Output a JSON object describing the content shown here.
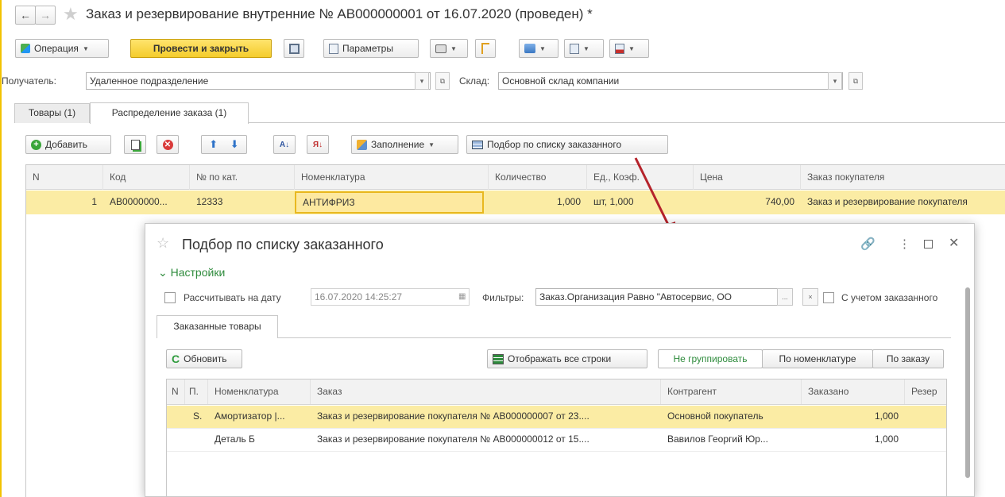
{
  "window": {
    "title": "Заказ и резервирование внутренние № АВ000000001 от 16.07.2020 (проведен) *"
  },
  "toolbar": {
    "operation_label": "Операция",
    "post_close_label": "Провести и закрыть",
    "params_label": "Параметры"
  },
  "header_fields": {
    "recipient_label": "Получатель:",
    "recipient_value": "Удаленное подразделение",
    "warehouse_label": "Склад:",
    "warehouse_value": "Основной склад компании"
  },
  "tabs": [
    {
      "label": "Товары (1)"
    },
    {
      "label": "Распределение заказа (1)"
    }
  ],
  "tab_toolbar": {
    "add_label": "Добавить",
    "fill_label": "Заполнение",
    "pick_label": "Подбор по списку заказанного"
  },
  "table": {
    "columns": [
      "N",
      "Код",
      "№ по кат.",
      "Номенклатура",
      "Количество",
      "Ед., Коэф.",
      "Цена",
      "Заказ покупателя"
    ],
    "rows": [
      [
        "1",
        "АВ0000000...",
        "12333",
        "АНТИФРИЗ",
        "1,000",
        "шт, 1,000",
        "740,00",
        "Заказ и резервирование покупателя"
      ]
    ]
  },
  "dialog": {
    "title": "Подбор по списку заказанного",
    "settings_label": "Настройки",
    "calc_on_date_label": "Рассчитывать на дату",
    "date_value": "16.07.2020 14:25:27",
    "filters_label": "Фильтры:",
    "filters_value": "Заказ.Организация Равно \"Автосервис, ОО",
    "with_ordered_label": "С учетом заказанного",
    "tab_label": "Заказанные товары",
    "refresh_label": "Обновить",
    "show_all_label": "Отображать все строки",
    "group_none_label": "Не группировать",
    "group_item_label": "По номенклатуре",
    "group_order_label": "По заказу",
    "columns": [
      "N",
      "П.",
      "Номенклатура",
      "Заказ",
      "Контрагент",
      "Заказано",
      "Резер"
    ],
    "rows": [
      [
        "",
        "S.",
        "Амортизатор |...",
        "Заказ и резервирование покупателя № АВ000000007 от 23....",
        "Основной покупатель",
        "1,000",
        ""
      ],
      [
        "",
        "",
        "Деталь Б",
        "Заказ и резервирование покупателя № АВ000000012 от 15....",
        "Вавилов Георгий Юр...",
        "1,000",
        ""
      ]
    ]
  },
  "colors": {
    "accent_yellow": "#fdd94e",
    "selected_row": "#fbeca4",
    "settings_green": "#2e8b3c",
    "arrow_red": "#b5232b"
  }
}
